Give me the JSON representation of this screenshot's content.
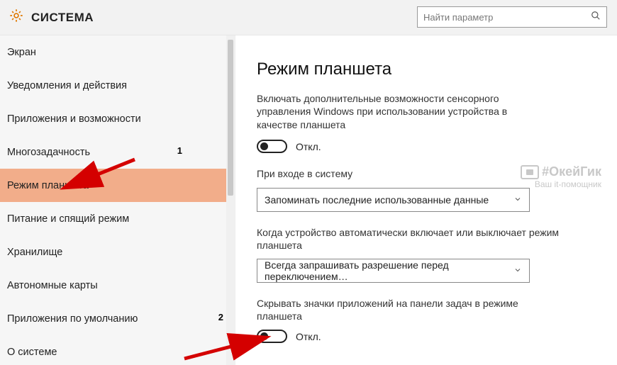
{
  "header": {
    "title": "СИСТЕМА",
    "search_placeholder": "Найти параметр"
  },
  "sidebar": {
    "items": [
      {
        "label": "Экран"
      },
      {
        "label": "Уведомления и действия"
      },
      {
        "label": "Приложения и возможности"
      },
      {
        "label": "Многозадачность"
      },
      {
        "label": "Режим планшета"
      },
      {
        "label": "Питание и спящий режим"
      },
      {
        "label": "Хранилище"
      },
      {
        "label": "Автономные карты"
      },
      {
        "label": "Приложения по умолчанию"
      },
      {
        "label": "О системе"
      }
    ],
    "selected_index": 4
  },
  "content": {
    "title": "Режим планшета",
    "desc": "Включать дополнительные возможности сенсорного управления Windows при использовании устройства в качестве планшета",
    "toggle1_state": "Откл.",
    "field1_label": "При входе в систему",
    "field1_value": "Запоминать последние использованные данные",
    "field2_label": "Когда устройство автоматически включает или выключает режим планшета",
    "field2_value": "Всегда запрашивать разрешение перед переключением…",
    "field3_label": "Скрывать значки приложений на панели задач в режиме планшета",
    "toggle2_state": "Откл."
  },
  "annotations": {
    "badge1": "1",
    "badge2": "2"
  },
  "watermark": {
    "line1": "#ОкейГик",
    "line2": "Ваш it-помощник"
  }
}
